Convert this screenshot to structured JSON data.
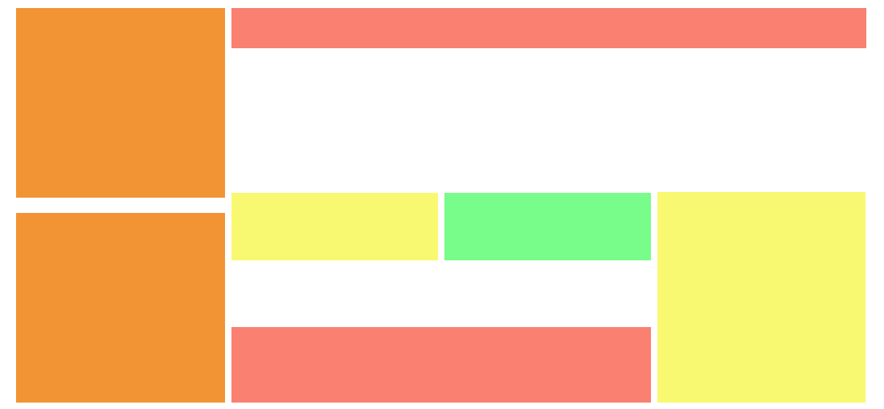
{
  "colors": {
    "orange": "#F29433",
    "salmon": "#FA8072",
    "yellow": "#F9F871",
    "green": "#78FC8A",
    "background": "#FFFFFF"
  },
  "blocks": [
    {
      "id": "b-orange-top",
      "color_key": "orange"
    },
    {
      "id": "b-orange-bottom",
      "color_key": "orange"
    },
    {
      "id": "b-red-top",
      "color_key": "salmon"
    },
    {
      "id": "b-yellow-1",
      "color_key": "yellow"
    },
    {
      "id": "b-green",
      "color_key": "green"
    },
    {
      "id": "b-yellow-2",
      "color_key": "yellow"
    },
    {
      "id": "b-red-bottom",
      "color_key": "salmon"
    }
  ]
}
